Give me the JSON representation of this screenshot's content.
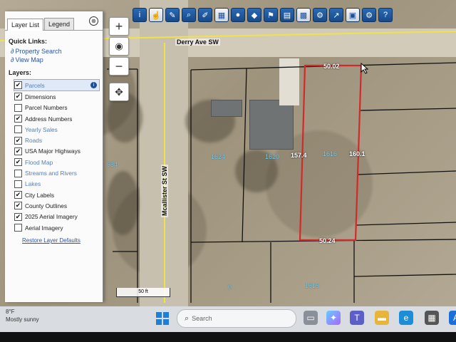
{
  "map": {
    "streets": {
      "horizontal": "Derry Ave SW",
      "vertical": "Mcallister St SW"
    },
    "parcels": [
      "1624",
      "1620",
      "1616",
      "1615",
      "634",
      "0"
    ],
    "dimensions": {
      "top": "50.02",
      "left": "157.4",
      "right": "160.1",
      "bottom": "50.24"
    },
    "scale_label": "50 ft"
  },
  "toolbar": {
    "tools": [
      "info-icon",
      "select-icon",
      "measure-icon",
      "query-icon",
      "draw-icon",
      "print-icon",
      "marker-icon",
      "layers-icon",
      "bookmark-icon",
      "basemap-icon",
      "photo-icon",
      "tools-icon",
      "export-icon",
      "share-icon",
      "settings-icon",
      "help-icon"
    ]
  },
  "panel": {
    "tabs": [
      "Layer List",
      "Legend"
    ],
    "close_glyph": "⊗",
    "quick_links_title": "Quick Links:",
    "quick_links": [
      "Property Search",
      "View Map"
    ],
    "layers_title": "Layers:",
    "layers": [
      {
        "label": "Parcels",
        "checked": true,
        "linked": true,
        "selected": true
      },
      {
        "label": "Dimensions",
        "checked": true,
        "linked": false
      },
      {
        "label": "Parcel Numbers",
        "checked": false,
        "linked": false
      },
      {
        "label": "Address Numbers",
        "checked": true,
        "linked": false
      },
      {
        "label": "Yearly Sales",
        "checked": false,
        "linked": true
      },
      {
        "label": "Roads",
        "checked": true,
        "linked": true
      },
      {
        "label": "USA Major Highways",
        "checked": true,
        "linked": false
      },
      {
        "label": "Flood Map",
        "checked": true,
        "linked": true
      },
      {
        "label": "Streams and Rivers",
        "checked": false,
        "linked": true
      },
      {
        "label": "Lakes",
        "checked": false,
        "linked": true
      },
      {
        "label": "City Labels",
        "checked": true,
        "linked": false
      },
      {
        "label": "County Outlines",
        "checked": true,
        "linked": false
      },
      {
        "label": "2025 Aerial Imagery",
        "checked": true,
        "linked": false
      },
      {
        "label": "Aerial Imagery",
        "checked": false,
        "linked": false
      }
    ],
    "restore_link": "Restore Layer Defaults"
  },
  "zoom": {
    "in": "+",
    "out": "−"
  },
  "taskbar": {
    "weather_temp": "8°F",
    "weather_desc": "Mostly sunny",
    "search_placeholder": "Search"
  },
  "colors": {
    "parcel_highlight": "#d12a2a",
    "layer_link": "#2d55a3",
    "parcel_number": "#7fd4ea"
  }
}
